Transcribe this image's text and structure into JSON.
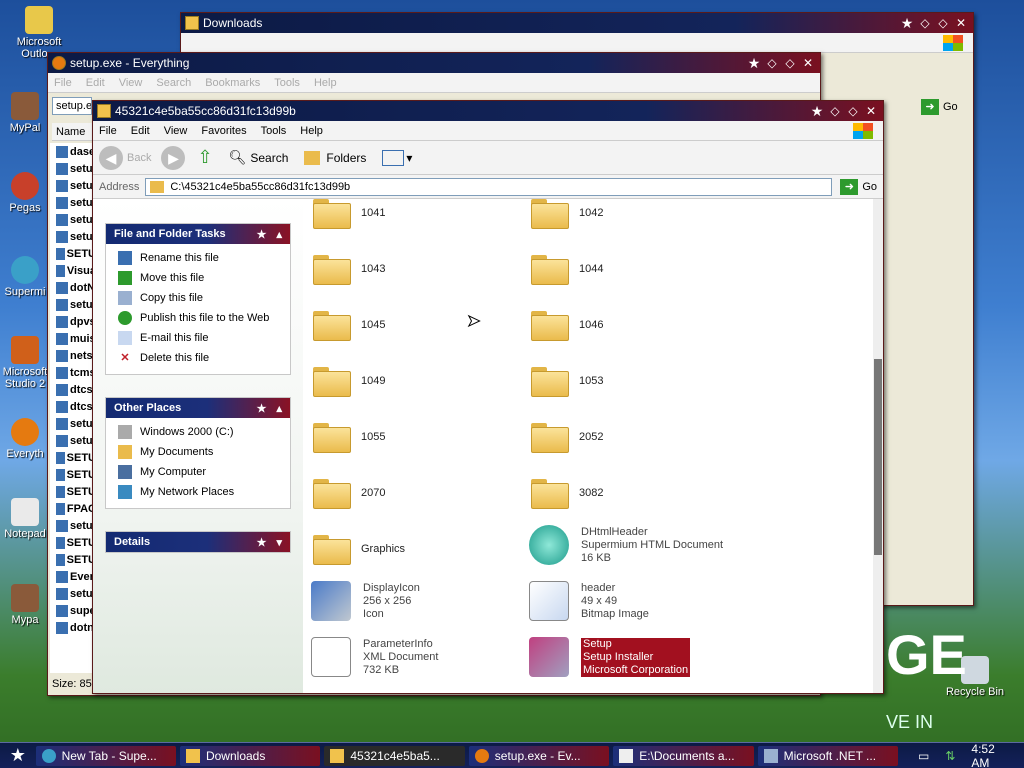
{
  "desktop": {
    "icons": [
      {
        "label": "Microsoft Outlo...",
        "icon": "outlook-icon"
      },
      {
        "label": "MyPal",
        "icon": "mypal-icon"
      },
      {
        "label": "Pegas",
        "icon": "pegasus-icon"
      },
      {
        "label": "Supermi",
        "icon": "supermium-icon"
      },
      {
        "label": "Microsoft Studio 2",
        "icon": "visual-studio-icon"
      },
      {
        "label": "Everyth",
        "icon": "everything-icon"
      },
      {
        "label": "Notepad",
        "icon": "notepad-icon"
      },
      {
        "label": "Mypa",
        "icon": "mypal-icon"
      },
      {
        "label": "Recycle Bin",
        "icon": "recycle-bin-icon"
      }
    ]
  },
  "windows": {
    "downloads": {
      "title": "Downloads"
    },
    "everything": {
      "title": "setup.exe - Everything",
      "menu": [
        "File",
        "Edit",
        "View",
        "Search",
        "Bookmarks",
        "Tools",
        "Help"
      ],
      "search_value": "setup.e",
      "column_name": "Name",
      "rows": [
        "dase",
        "setu",
        "setu",
        "setu",
        "setu",
        "setu",
        "SETU",
        "Visua",
        "dotN",
        "setu",
        "dpvs",
        "muis",
        "nets",
        "tcms",
        "dtcs",
        "dtcs",
        "setu",
        "setu",
        "SETU",
        "SETU",
        "SETU",
        "FPAC",
        "setu",
        "SETU",
        "SETU",
        "Ever",
        "setu",
        "supe",
        "dotn"
      ],
      "status": "Size: 85.."
    },
    "explorer": {
      "title": "45321c4e5ba55cc86d31fc13d99b",
      "menu": [
        "File",
        "Edit",
        "View",
        "Favorites",
        "Tools",
        "Help"
      ],
      "toolbar": {
        "back": "Back",
        "search": "Search",
        "folders": "Folders"
      },
      "address_label": "Address",
      "address_value": "C:\\45321c4e5ba55cc86d31fc13d99b",
      "go_label": "Go",
      "tasks_panel": {
        "title": "File and Folder Tasks",
        "items": [
          "Rename this file",
          "Move this file",
          "Copy this file",
          "Publish this file to the Web",
          "E-mail this file",
          "Delete this file"
        ]
      },
      "places_panel": {
        "title": "Other Places",
        "items": [
          "Windows 2000 (C:)",
          "My Documents",
          "My Computer",
          "My Network Places"
        ]
      },
      "details_panel": {
        "title": "Details"
      },
      "folders": [
        "1041",
        "1042",
        "1043",
        "1044",
        "1045",
        "1046",
        "1049",
        "1053",
        "1055",
        "2052",
        "2070",
        "3082",
        "Graphics"
      ],
      "files": [
        {
          "name": "DHtmlHeader",
          "line2": "Supermium HTML Document",
          "line3": "16 KB"
        },
        {
          "name": "DisplayIcon",
          "line2": "256 x 256",
          "line3": "Icon"
        },
        {
          "name": "header",
          "line2": "49 x 49",
          "line3": "Bitmap Image"
        },
        {
          "name": "ParameterInfo",
          "line2": "XML Document",
          "line3": "732 KB"
        },
        {
          "name": "Setup",
          "line2": "Setup Installer",
          "line3": "Microsoft Corporation"
        }
      ]
    }
  },
  "taskbar": {
    "items": [
      "New Tab - Supe...",
      "Downloads",
      "45321c4e5ba5...",
      "setup.exe - Ev...",
      "E:\\Documents a...",
      "Microsoft .NET ..."
    ],
    "clock": "4:52 AM"
  },
  "wallpaper_text": {
    "big": "GE",
    "small": "VE IN"
  }
}
